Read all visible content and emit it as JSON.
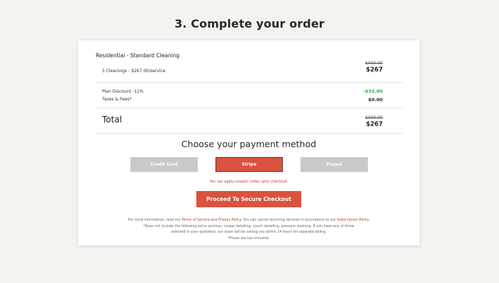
{
  "page_title": "3. Complete your order",
  "order": {
    "plan_name": "Residential - Standard Cleaning",
    "line_item": "5 Cleanings - $267.00/service",
    "original_price": "$300.00",
    "price": "$267",
    "discount_label": "Plan Discount -11%",
    "discount_value": "-$33.00",
    "taxes_label": "Taxes & Fees*",
    "taxes_value": "$0.00",
    "total_label": "Total",
    "total_original": "$300.00",
    "total_price": "$267"
  },
  "payment": {
    "title": "Choose your payment method",
    "methods": [
      "Credit Card",
      "Stripe",
      "Paypal"
    ],
    "selected": "Stripe",
    "coupon_note": "You can apply coupon codes upon checkout.",
    "checkout_label": "Proceed To Secure Checkout"
  },
  "footer": {
    "line1_a": "For more information, read our ",
    "terms": "Terms of Service",
    "and": " and ",
    "privacy": "Privacy Policy",
    "line1_b": ". You can cancel recurring services in accordance to our ",
    "subscription": "Subscription Policy",
    "line1_c": ".",
    "line2": "*Does not include the following extra services: carpet detailing, couch detailing, pressure washing. If you have any of these",
    "line3": "selected in your quotation, our team will be calling you within 24 hours for separate billing.",
    "line4": "*Prices are tax-inclusive."
  },
  "colors": {
    "accent": "#d95340",
    "discount_green": "#3aa83a",
    "inactive_button": "#c9c9c9",
    "background": "#f4f3f0"
  }
}
